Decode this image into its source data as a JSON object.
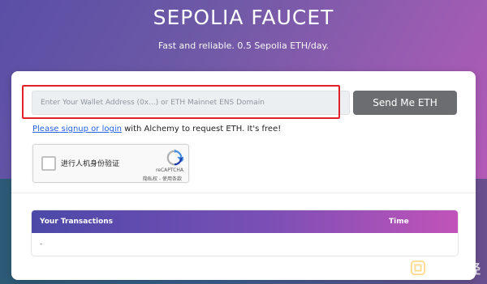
{
  "header": {
    "title": "SEPOLIA FAUCET",
    "subtitle": "Fast and reliable. 0.5 Sepolia ETH/day."
  },
  "form": {
    "address_placeholder": "Enter Your Wallet Address (0x...) or ETH Mainnet ENS Domain",
    "address_value": "",
    "send_button_label": "Send Me ETH"
  },
  "signup": {
    "link_text": "Please signup or login",
    "rest_text": " with Alchemy to request ETH. It's free!"
  },
  "recaptcha": {
    "label": "进行人机身份验证",
    "brand": "reCAPTCHA",
    "terms": "隐私权 - 使用条款",
    "checked": false
  },
  "transactions": {
    "header_label": "Your Transactions",
    "time_label": "Time",
    "rows": [
      "-"
    ]
  },
  "watermark": {
    "text": "金色财经"
  },
  "colors": {
    "accent_red": "#e0202a",
    "send_button_bg": "#6b6d70",
    "link_blue": "#2563eb"
  }
}
